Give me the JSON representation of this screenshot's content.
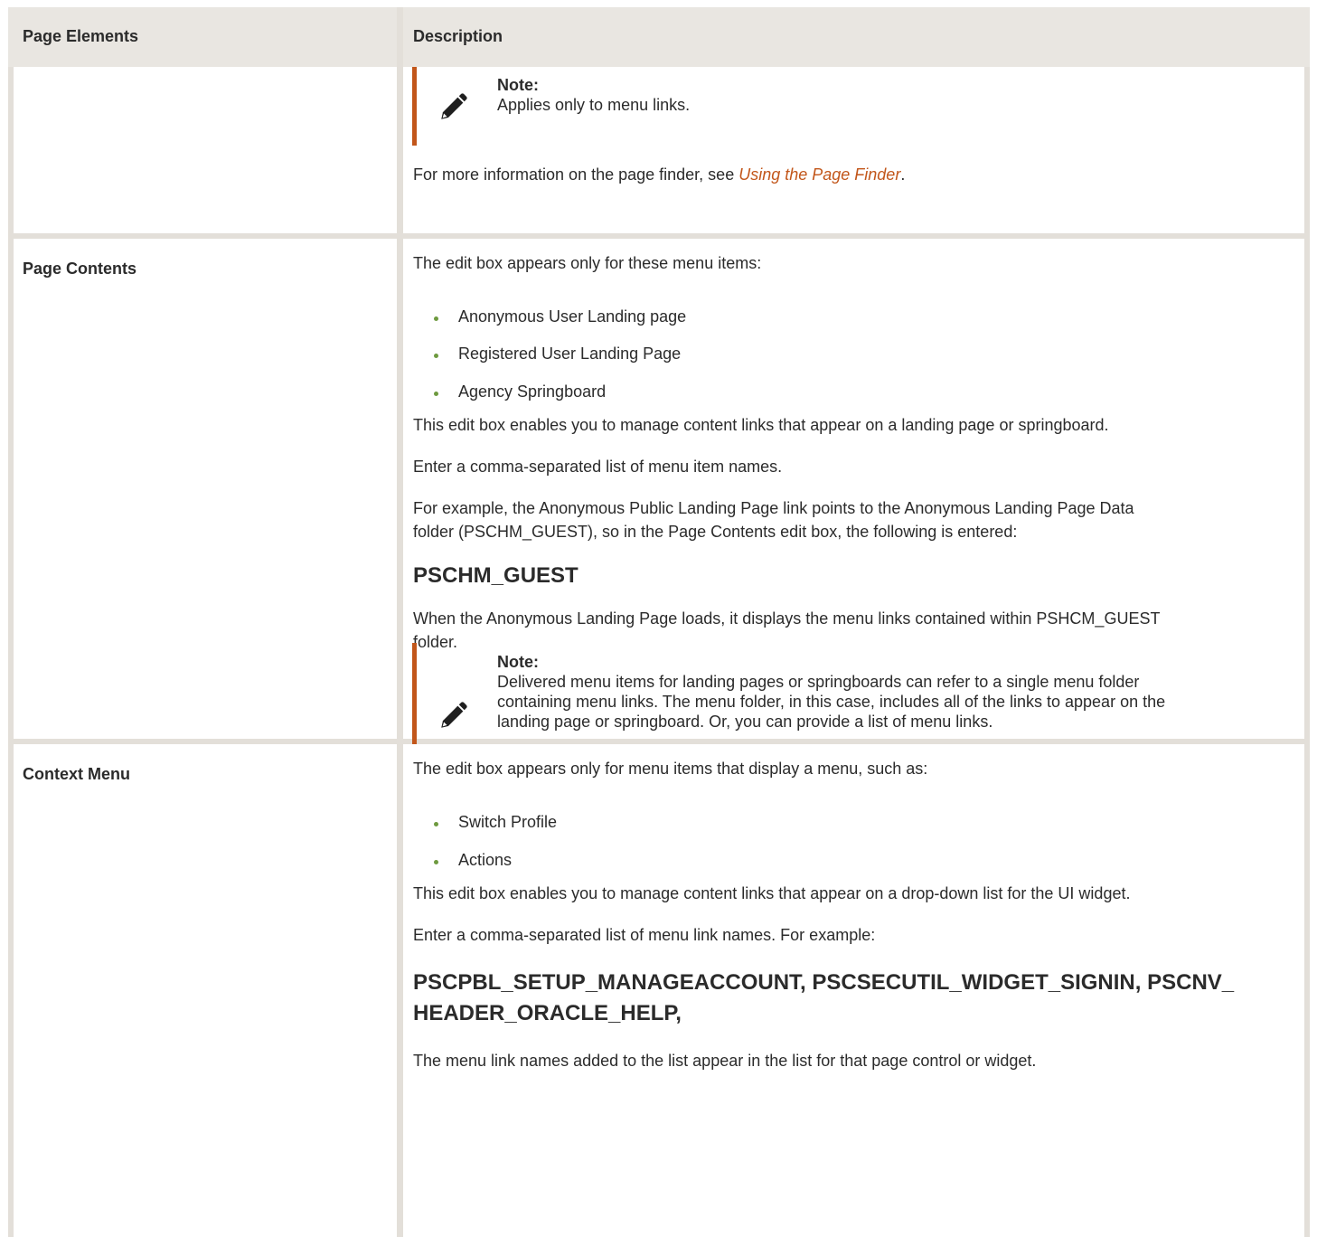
{
  "table": {
    "headers": {
      "col1": "Page Elements",
      "col2": "Description"
    },
    "row1": {
      "label": "",
      "note": {
        "title": "Note:",
        "lines": [
          "Applies only to menu links."
        ]
      },
      "text_prefix": "For more information on the page finder, see ",
      "link": "Using the Page Finder",
      "text_suffix": "."
    },
    "row2": {
      "label": "Page Contents",
      "intro": "The edit box appears only for these menu items:",
      "bullets": [
        "Anonymous User Landing page",
        "Registered User Landing Page",
        "Agency Springboard"
      ],
      "paragraphs": [
        "This edit box enables you to manage content links that appear on a landing page or springboard.",
        "Enter a comma-separated list of menu item names.",
        "For example, the Anonymous Public Landing Page link points to the Anonymous Landing Page Data",
        "folder (PSCHM_GUEST), so in the Page Contents edit box, the following is entered:"
      ],
      "code": "PSCHM_GUEST",
      "after_code": [
        "When the Anonymous Landing Page loads, it displays the menu links contained within PSHCM_GUEST",
        "folder."
      ],
      "note": {
        "title": "Note:",
        "lines": [
          "Delivered menu items for landing pages or springboards can refer to a single menu folder",
          "containing menu links. The menu folder, in this case, includes all of the links to appear on the",
          "landing page or springboard. Or, you can provide a list of menu links."
        ]
      }
    },
    "row3": {
      "label": "Context Menu",
      "intro": "The edit box appears only for menu items that display a menu, such as:",
      "bullets": [
        "Switch Profile",
        "Actions"
      ],
      "paragraphs": [
        "This edit box enables you to manage content links that appear on a drop-down list for the UI widget.",
        "Enter a comma-separated list of menu link names. For example:"
      ],
      "code_lines": [
        "PSCPBL_SETUP_MANAGEACCOUNT, PSCSECUTIL_WIDGET_SIGNIN, PSCNV_",
        "HEADER_ORACLE_HELP,"
      ],
      "closing": "The menu link names added to the list appear in the list for that page control or widget."
    }
  },
  "colors": {
    "accent": "#c2561a",
    "bullet": "#6e9a3f",
    "border": "#e3dfd9"
  }
}
